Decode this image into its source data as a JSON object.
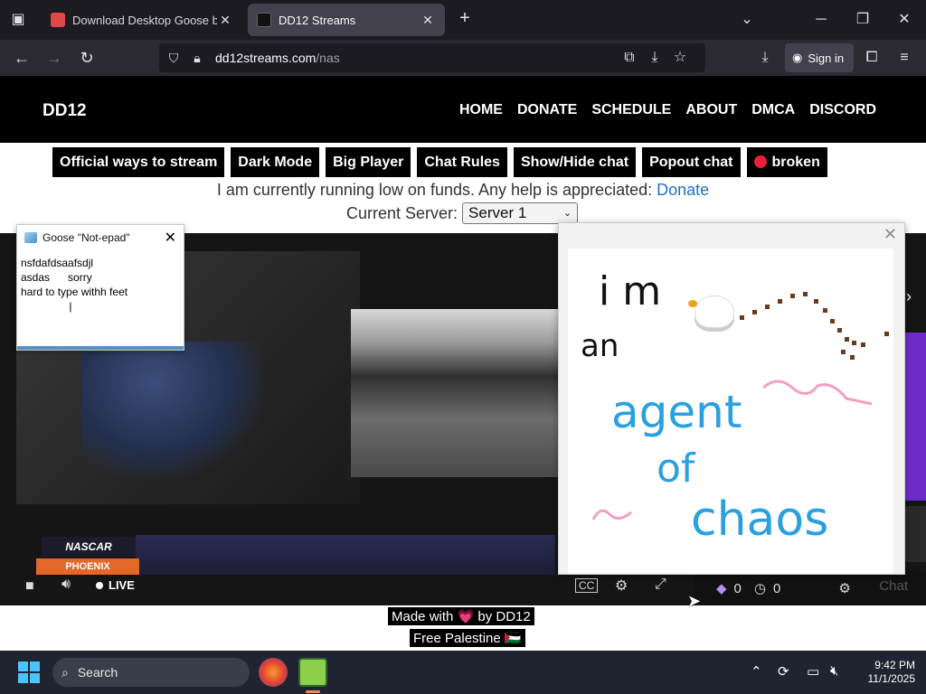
{
  "browser": {
    "tabs": [
      {
        "title": "Download Desktop Goose by sa",
        "active": false
      },
      {
        "title": "DD12 Streams",
        "active": true
      }
    ],
    "new_tab": "+",
    "url_host": "dd12streams.com",
    "url_path": "/nas",
    "sign_in": "Sign in"
  },
  "site": {
    "logo": "DD12",
    "nav": [
      "HOME",
      "DONATE",
      "SCHEDULE",
      "ABOUT",
      "DMCA",
      "DISCORD"
    ],
    "buttons": [
      "Official ways to stream",
      "Dark Mode",
      "Big Player",
      "Chat Rules",
      "Show/Hide chat",
      "Popout chat"
    ],
    "status_button": "broken",
    "funds_text": "I am currently running low on funds. Any help is appreciated:",
    "funds_link": "Donate",
    "server_label": "Current Server:",
    "server_selected": "Server 1"
  },
  "player": {
    "badge_top": "NASCAR",
    "badge_bottom": "PHOENIX",
    "live": "LIVE",
    "chat_count_a": "0",
    "chat_count_b": "0",
    "chat_button": "Chat"
  },
  "notepad": {
    "title": "Goose \"Not-epad\"",
    "text": "nsfdafdsaafsdjl\nasdas      sorry\nhard to type withh feet\n                |"
  },
  "drawing": {
    "line1": "i m",
    "line2": "an",
    "line3": "agent",
    "line4": "of",
    "line5": "chaos"
  },
  "footer": {
    "made_with": "Made with 💗 by DD12",
    "palestine": "Free Palestine 🇵🇸"
  },
  "taskbar": {
    "search": "Search",
    "time": "9:42 PM",
    "date": "11/1/2025"
  },
  "colors": {
    "donate_link": "#1a73c8",
    "status_dot": "#e8203a",
    "chat_purple": "#6d2cc9"
  }
}
